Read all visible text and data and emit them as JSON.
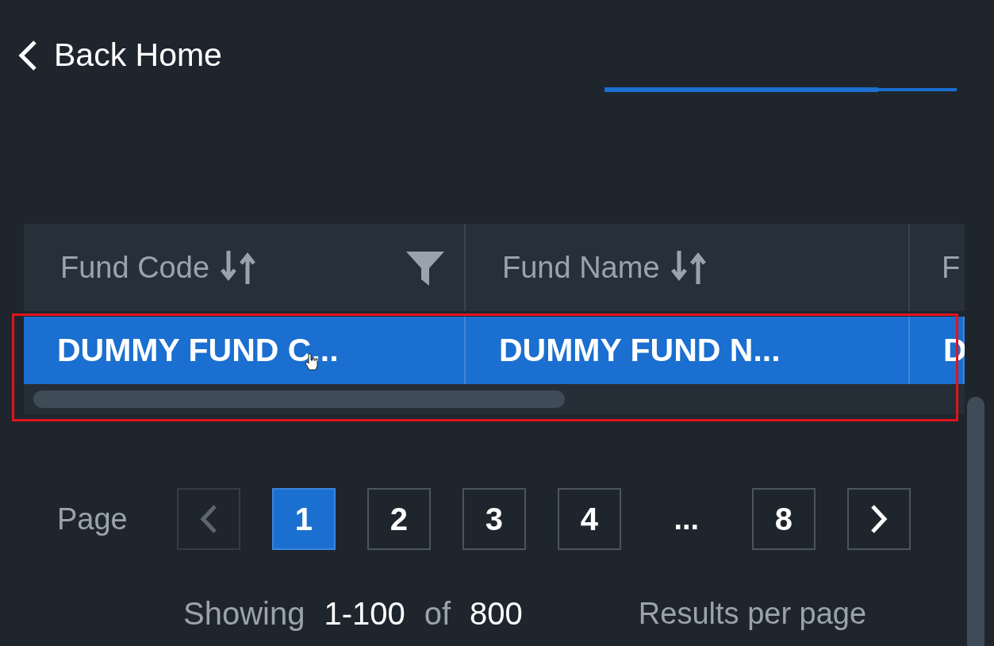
{
  "back_link": {
    "label": "Back Home"
  },
  "table": {
    "columns": [
      {
        "label": "Fund Code",
        "sortable": true,
        "filter": true
      },
      {
        "label": "Fund Name",
        "sortable": true,
        "filter": false
      },
      {
        "label": "F"
      }
    ],
    "rows": [
      {
        "selected": true,
        "cells": [
          "DUMMY FUND C...",
          "DUMMY FUND N...",
          "D"
        ]
      }
    ]
  },
  "pagination": {
    "label": "Page",
    "prev_disabled": true,
    "next_disabled": false,
    "pages": [
      {
        "kind": "page",
        "label": "1",
        "selected": true
      },
      {
        "kind": "page",
        "label": "2",
        "selected": false
      },
      {
        "kind": "page",
        "label": "3",
        "selected": false
      },
      {
        "kind": "page",
        "label": "4",
        "selected": false
      },
      {
        "kind": "ellipsis",
        "label": "..."
      },
      {
        "kind": "page",
        "label": "8",
        "selected": false
      }
    ]
  },
  "summary": {
    "prefix": "Showing",
    "range": "1-100",
    "of": "of",
    "total": "800",
    "per_page_label": "Results per page"
  }
}
